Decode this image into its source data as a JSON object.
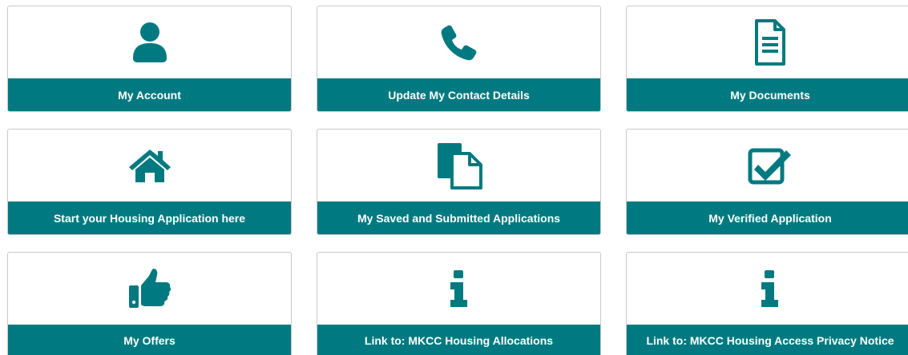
{
  "accent_color": "#007a80",
  "tiles": [
    {
      "label": "My Account",
      "icon": "user-icon"
    },
    {
      "label": "Update My Contact Details",
      "icon": "phone-icon"
    },
    {
      "label": "My Documents",
      "icon": "document-icon"
    },
    {
      "label": "Start your Housing Application here",
      "icon": "home-icon"
    },
    {
      "label": "My Saved and Submitted Applications",
      "icon": "files-icon"
    },
    {
      "label": "My Verified Application",
      "icon": "checkbox-icon"
    },
    {
      "label": "My Offers",
      "icon": "thumbs-up-icon"
    },
    {
      "label": "Link to: MKCC Housing Allocations",
      "icon": "info-icon"
    },
    {
      "label": "Link to: MKCC Housing Access Privacy Notice",
      "icon": "info-icon"
    }
  ]
}
